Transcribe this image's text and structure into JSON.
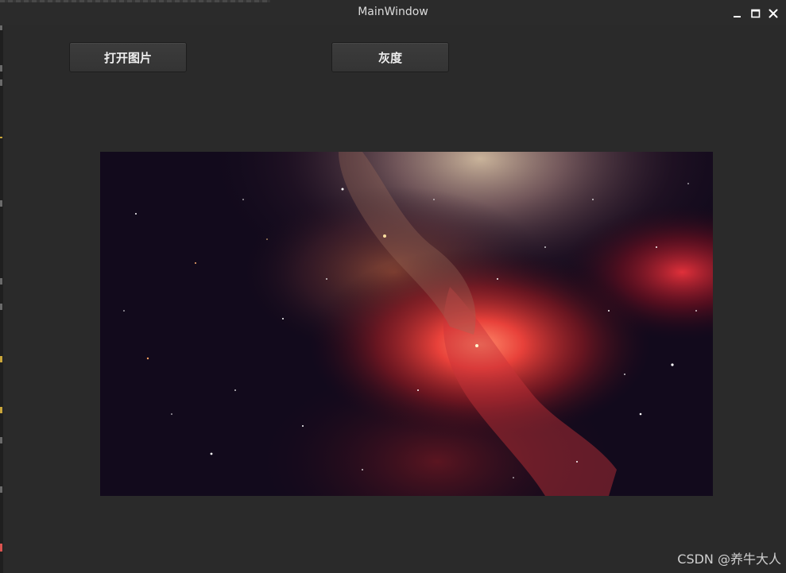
{
  "window": {
    "title": "MainWindow"
  },
  "toolbar": {
    "open_image_label": "打开图片",
    "grayscale_label": "灰度"
  },
  "image": {
    "description_icon": "nebula-image"
  },
  "watermark": {
    "text": "CSDN @养牛大人"
  },
  "colors": {
    "window_bg": "#2a2a2a",
    "button_bg": "#3a3a3a",
    "text": "#eeeeee"
  }
}
